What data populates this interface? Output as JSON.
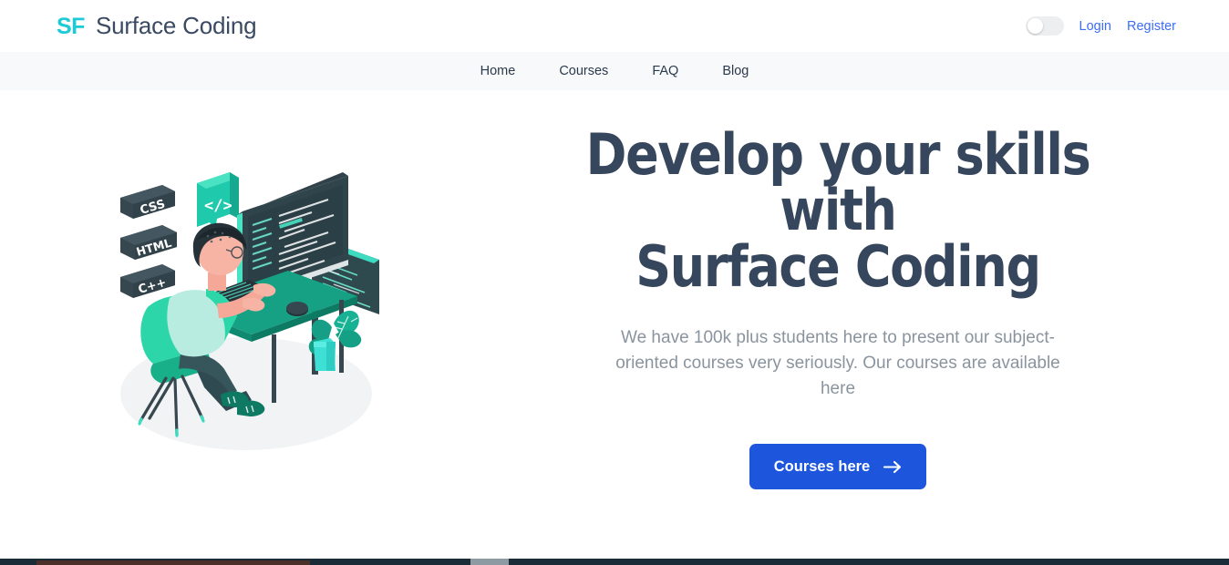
{
  "header": {
    "logo_mark": "SF",
    "brand_name": "Surface Coding",
    "toggle": {
      "name": "theme-toggle",
      "state": "off"
    },
    "login_label": "Login",
    "register_label": "Register"
  },
  "nav": {
    "items": [
      {
        "label": "Home"
      },
      {
        "label": "Courses"
      },
      {
        "label": "FAQ"
      },
      {
        "label": "Blog"
      }
    ]
  },
  "hero": {
    "title_line1": "Develop your skills with",
    "title_line2": "Surface Coding",
    "subtitle": "We have 100k plus students here to present our subject-oriented courses very seriously. Our courses are available here",
    "cta_label": "Courses here",
    "cta_icon": "arrow-right-icon",
    "illustration": {
      "name": "developer-at-desk-illustration",
      "badges": [
        "CSS",
        "HTML",
        "C++"
      ],
      "code_bubble": "</>"
    }
  },
  "colors": {
    "brand_cyan": "#1dcad6",
    "heading_navy": "#36465d",
    "link_blue": "#3c6ef4",
    "cta_blue": "#1d56dd",
    "nav_band": "#f8f9fb",
    "body_gray": "#8a949e",
    "illo_teal": "#2dd6b5",
    "illo_green": "#128f77",
    "illo_slate": "#37474f",
    "footer_strip": "#1b2c39"
  }
}
